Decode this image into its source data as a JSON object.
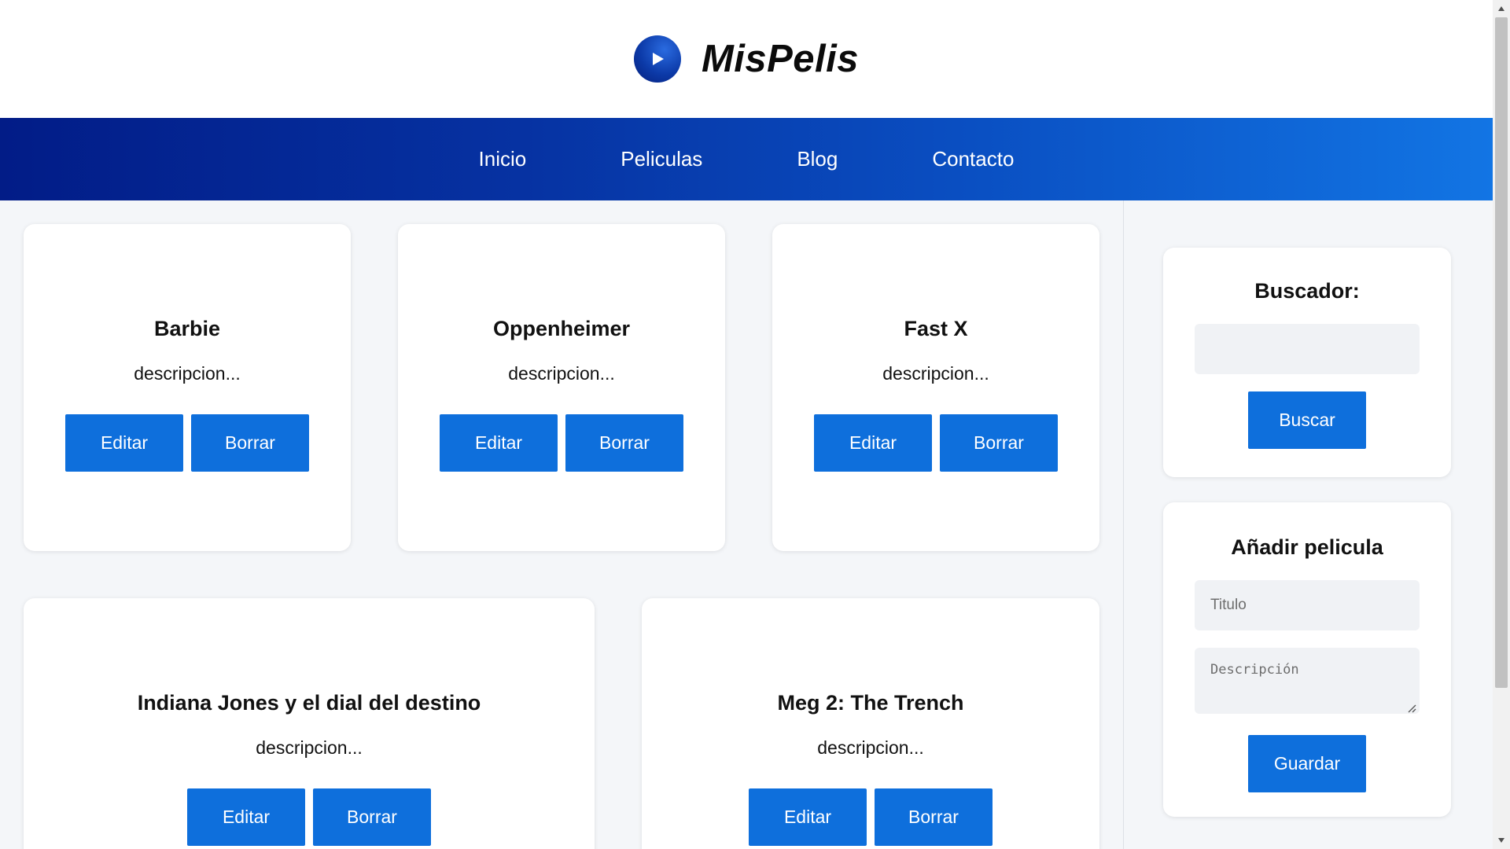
{
  "brand": {
    "name": "MisPelis",
    "icon": "play-icon"
  },
  "nav": {
    "items": [
      "Inicio",
      "Peliculas",
      "Blog",
      "Contacto"
    ]
  },
  "movies": [
    {
      "title": "Barbie",
      "description": "descripcion...",
      "edit_label": "Editar",
      "delete_label": "Borrar"
    },
    {
      "title": "Oppenheimer",
      "description": "descripcion...",
      "edit_label": "Editar",
      "delete_label": "Borrar"
    },
    {
      "title": "Fast X",
      "description": "descripcion...",
      "edit_label": "Editar",
      "delete_label": "Borrar"
    },
    {
      "title": "Indiana Jones y el dial del destino",
      "description": "descripcion...",
      "edit_label": "Editar",
      "delete_label": "Borrar"
    },
    {
      "title": "Meg 2: The Trench",
      "description": "descripcion...",
      "edit_label": "Editar",
      "delete_label": "Borrar"
    }
  ],
  "search": {
    "title": "Buscador:",
    "value": "",
    "placeholder": "",
    "button_label": "Buscar"
  },
  "add_movie": {
    "title": "Añadir pelicula",
    "title_placeholder": "Titulo",
    "description_placeholder": "Descripción",
    "button_label": "Guardar"
  },
  "colors": {
    "accent": "#0e6fdc",
    "nav_gradient_start": "#021c87",
    "nav_gradient_end": "#1275e4",
    "background": "#f4f6f9"
  }
}
